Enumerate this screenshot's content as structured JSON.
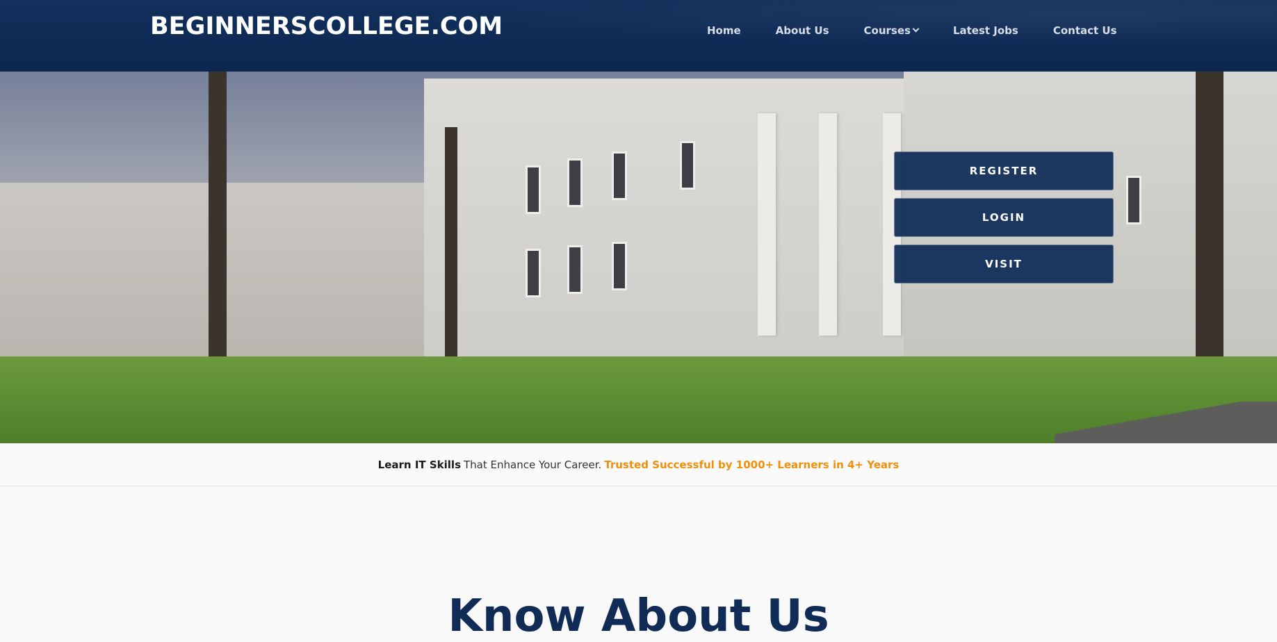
{
  "header": {
    "brand": "BEGINNERSCOLLEGE.COM",
    "nav": [
      {
        "label": "Home"
      },
      {
        "label": "About Us"
      },
      {
        "label": "Courses",
        "has_dropdown": true
      },
      {
        "label": "Latest Jobs"
      },
      {
        "label": "Contact Us"
      }
    ]
  },
  "hero": {
    "image": "college-campus-photo",
    "buttons": [
      "REGISTER",
      "LOGIN",
      "VISIT"
    ]
  },
  "tagline": {
    "strong": "Learn IT Skills",
    "normal": "That Enhance Your Career.",
    "accent": "Trusted Successful by 1000+ Learners in 4+ Years"
  },
  "about": {
    "title": "Know About Us"
  },
  "colors": {
    "header_bg": "#0f2b56",
    "button_bg": "#0c2a56",
    "accent": "#f0900a",
    "title": "#0f2b56"
  }
}
